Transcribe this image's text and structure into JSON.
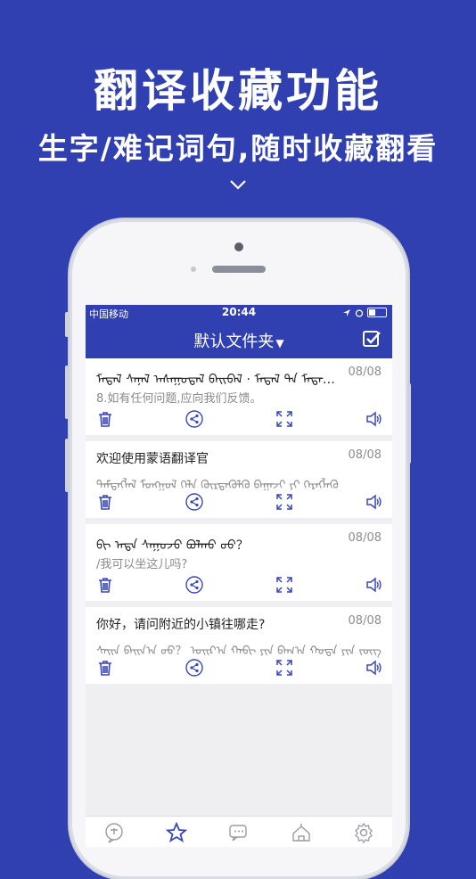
{
  "promo": {
    "title": "翻译收藏功能",
    "subtitle": "生字/难记词句,随时收藏翻看"
  },
  "status_bar": {
    "carrier": "中国移动",
    "time": "20:44"
  },
  "nav": {
    "title": "默认文件夹",
    "caret": "▼"
  },
  "items": [
    {
      "primary": "ᠮᠡᠳᠡᠯ ᠰᠠᠨᠠᠯ ᠠᠰᠠᠭᠤᠳᠠᠯ ᠪᠠᠢᠪᠠᠯ · ᠮᠡᠳᠡᠯ ᠲᠡ ᠮᠡᠳᠡᠭᠦ...",
      "secondary": "8.如有任何问题,应向我们反馈。",
      "date": "08/08"
    },
    {
      "primary": "欢迎使用蒙语翻译官",
      "secondary": "ᠲᠡᠮᠳᠡᠭᠯᠡᠯ ᠮᠣᠩᠭᠣᠯ ᠬᠡᠯᠡ ᠬᠦᠷᠳᠡᠭᠦᠯᠬᠦ ᠪᠠᠭᠠᠵᠢ ᠶᠢ ᠬᠡᠷᠡᠭᠯᠡᠬᠦ",
      "date": "08/08"
    },
    {
      "primary": "ᠪᠢ ᠡᠨᠳᠡ ᠰᠠᠭᠤᠵᠤ ᠪᠣᠯᠬᠤ ᠤᠤ？",
      "secondary": "/我可以坐这儿吗?",
      "date": "08/08"
    },
    {
      "primary": "你好，请问附近的小镇往哪走?",
      "secondary": "ᠰᠠᠢᠨ ᠪᠠᠢᠨ᠎ᠠ ᠤᠤ？ ᠣᠢᠷ᠎ᠠ ᠬᠠᠪᠢ ᠶᠢᠨ ᠪᠠᠭ᠎ᠠ ᠬᠣᠲᠠ ᠶᠢᠨ ᠵᠦᠭ",
      "date": "08/08"
    }
  ],
  "tabs": [
    "translate-tab-icon",
    "favorites-tab-icon",
    "chat-tab-icon",
    "culture-tab-icon",
    "settings-tab-icon"
  ],
  "colors": {
    "brand": "#3140b0",
    "accent": "#3a47b8"
  }
}
